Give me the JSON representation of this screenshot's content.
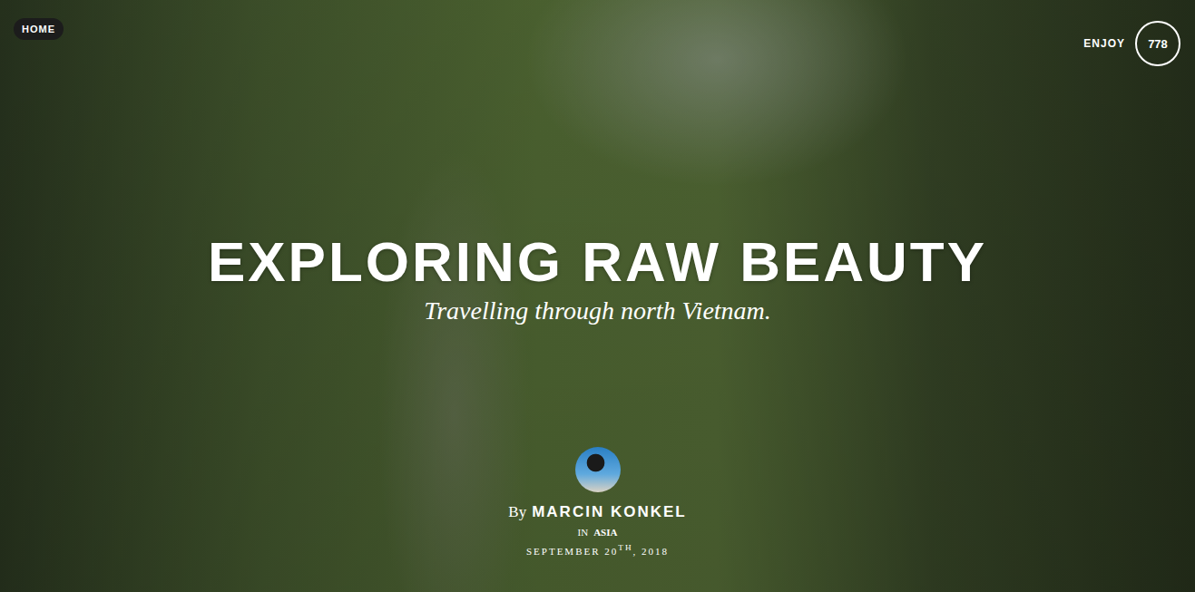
{
  "nav": {
    "home": "HOME",
    "enjoy_label": "ENJOY",
    "enjoy_count": "778"
  },
  "hero": {
    "title": "EXPLORING RAW BEAUTY",
    "subtitle": "Travelling through north Vietnam."
  },
  "author": {
    "by": "By",
    "name": "MARCIN KONKEL",
    "in": "IN",
    "category": "ASIA",
    "date": {
      "main": "SEPTEMBER 20",
      "suffix": "TH",
      "year": ", 2018"
    }
  }
}
